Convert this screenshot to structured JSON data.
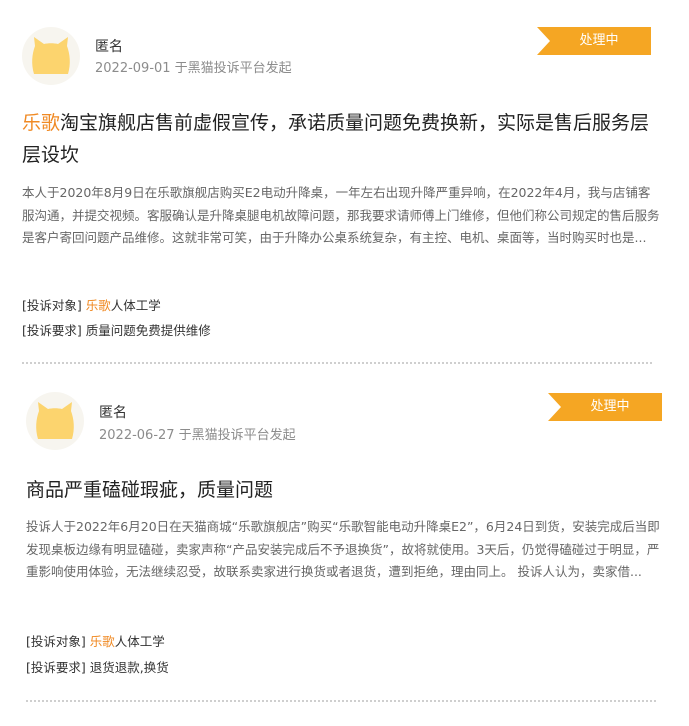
{
  "complaints": [
    {
      "user": "匿名",
      "meta": "2022-09-01 于黑猫投诉平台发起",
      "status": "处理中",
      "title_brand": "乐歌",
      "title_rest": "淘宝旗舰店售前虚假宣传，承诺质量问题免费换新，实际是售后服务层层设坎",
      "summary": "本人于2020年8月9日在乐歌旗舰店购买E2电动升降桌，一年左右出现升降严重异响，在2022年4月，我与店铺客服沟通，并提交视频。客服确认是升降桌腿电机故障问题，那我要求请师傅上门维修，但他们称公司规定的售后服务是客户寄回问题产品维修。这就非常可笑，由于升降办公桌系统复杂，有主控、电机、桌面等，当时购买时也是...",
      "target_label": "[投诉对象]",
      "target_brand": "乐歌",
      "target_rest": "人体工学",
      "request_label": "[投诉要求]",
      "request_value": "质量问题免费提供维修"
    },
    {
      "user": "匿名",
      "meta": "2022-06-27 于黑猫投诉平台发起",
      "status": "处理中",
      "title_brand": "",
      "title_rest": "商品严重磕碰瑕疵，质量问题",
      "summary": "投诉人于2022年6月20日在天猫商城“乐歌旗舰店”购买“乐歌智能电动升降桌E2”，6月24日到货，安装完成后当即发现桌板边缘有明显磕碰，卖家声称“产品安装完成后不予退换货”，故将就使用。3天后，仍觉得磕碰过于明显，严重影响使用体验，无法继续忍受，故联系卖家进行换货或者退货，遭到拒绝，理由同上。 投诉人认为，卖家借...",
      "target_label": "[投诉对象]",
      "target_brand": "乐歌",
      "target_rest": "人体工学",
      "request_label": "[投诉要求]",
      "request_value": "退货退款,换货"
    }
  ],
  "colors": {
    "status_bg": "#f5a623",
    "brand_text": "#f08a24",
    "avatar_cat": "#fcd46e"
  },
  "icons": {
    "avatar": "cat-face-icon"
  }
}
